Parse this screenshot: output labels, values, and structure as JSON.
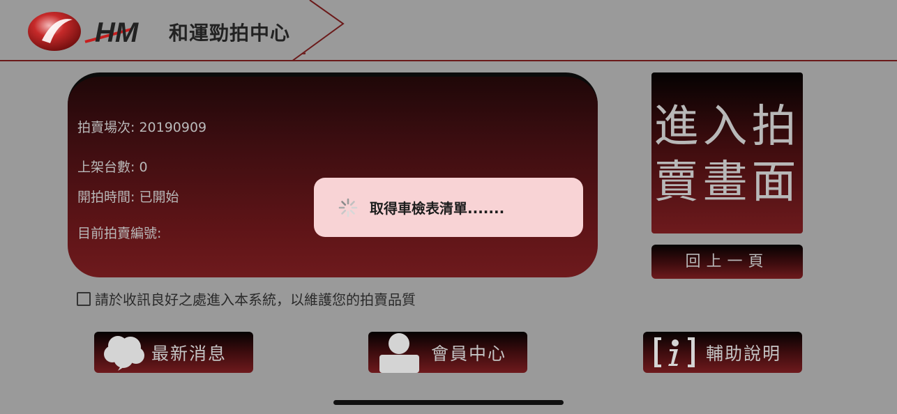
{
  "header": {
    "logo_text": "HM",
    "brand_name": "和運勁拍中心"
  },
  "info": {
    "session": "拍賣場次: 20190909",
    "vehicle_count": "上架台數: 0",
    "start_time": "開拍時間: 已開始",
    "current_number": "目前拍賣編號:"
  },
  "enter_button": {
    "line1": "進入拍",
    "line2": "賣畫面"
  },
  "back_button": {
    "label": "回上一頁"
  },
  "notice": {
    "checked": false,
    "text": "請於收訊良好之處進入本系統，以維護您的拍賣品質"
  },
  "bottom_nav": {
    "news": "最新消息",
    "member": "會員中心",
    "help": "輔助說明"
  },
  "toast": {
    "message": "取得車檢表清單......."
  },
  "colors": {
    "accent": "#6e1a1d",
    "background": "#9a9a9a",
    "toast_bg": "#f8d3d5"
  },
  "icons": {
    "logo": "hm-logo-icon",
    "news": "speech-bubble-icon",
    "member": "person-icon",
    "help": "info-icon",
    "loading": "spinner-icon"
  }
}
